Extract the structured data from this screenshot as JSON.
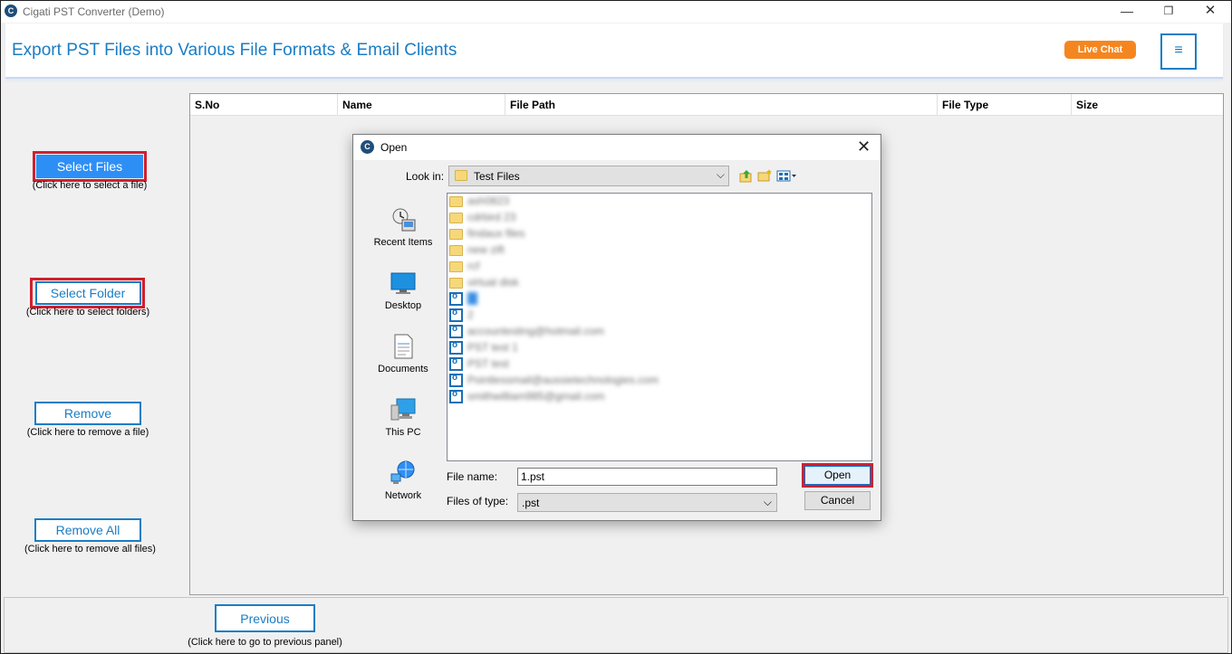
{
  "window": {
    "title": "Cigati PST Converter (Demo)",
    "controls": {
      "minimize": "—",
      "maximize": "❐",
      "close": "✕"
    }
  },
  "header": {
    "headline": "Export PST Files into Various File Formats & Email Clients",
    "live_chat": "Live Chat",
    "menu_icon": "≡"
  },
  "actions": {
    "select_files": {
      "label": "Select Files",
      "hint": "(Click here to select a file)"
    },
    "select_folder": {
      "label": "Select Folder",
      "hint": "(Click here to select folders)"
    },
    "remove": {
      "label": "Remove",
      "hint": "(Click here to remove a file)"
    },
    "remove_all": {
      "label": "Remove All",
      "hint": "(Click here to remove all files)"
    }
  },
  "table": {
    "columns": [
      "S.No",
      "Name",
      "File Path",
      "File Type",
      "Size"
    ]
  },
  "footer": {
    "previous": {
      "label": "Previous",
      "hint": "(Click here to go to previous panel)"
    }
  },
  "dialog": {
    "title": "Open",
    "close_icon": "✕",
    "look_in_label": "Look in:",
    "look_in_value": "Test Files",
    "places": [
      "Recent Items",
      "Desktop",
      "Documents",
      "This PC",
      "Network"
    ],
    "files": [
      {
        "type": "folder",
        "name": "ash0823"
      },
      {
        "type": "folder",
        "name": "cdrbird 23"
      },
      {
        "type": "folder",
        "name": "findaux files"
      },
      {
        "type": "folder",
        "name": "new zift"
      },
      {
        "type": "folder",
        "name": "rcf"
      },
      {
        "type": "folder",
        "name": "virtual disk"
      },
      {
        "type": "pst",
        "name": "1",
        "selected": true
      },
      {
        "type": "pst",
        "name": "2"
      },
      {
        "type": "pst",
        "name": "accountesting@hotmail.com"
      },
      {
        "type": "pst",
        "name": "PST test 1"
      },
      {
        "type": "pst",
        "name": "PST test"
      },
      {
        "type": "pst",
        "name": "Pointlessmail@aussietechnologies.com"
      },
      {
        "type": "pst",
        "name": "smithwilliam985@gmail.com"
      }
    ],
    "file_name_label": "File name:",
    "file_name_value": "1.pst",
    "file_type_label": "Files of type:",
    "file_type_value": ".pst",
    "open_label": "Open",
    "cancel_label": "Cancel"
  },
  "colors": {
    "accent": "#1a7dc4",
    "live_chat": "#f5861f",
    "highlight_box": "#d0202e",
    "primary_button": "#2d8ff5"
  }
}
